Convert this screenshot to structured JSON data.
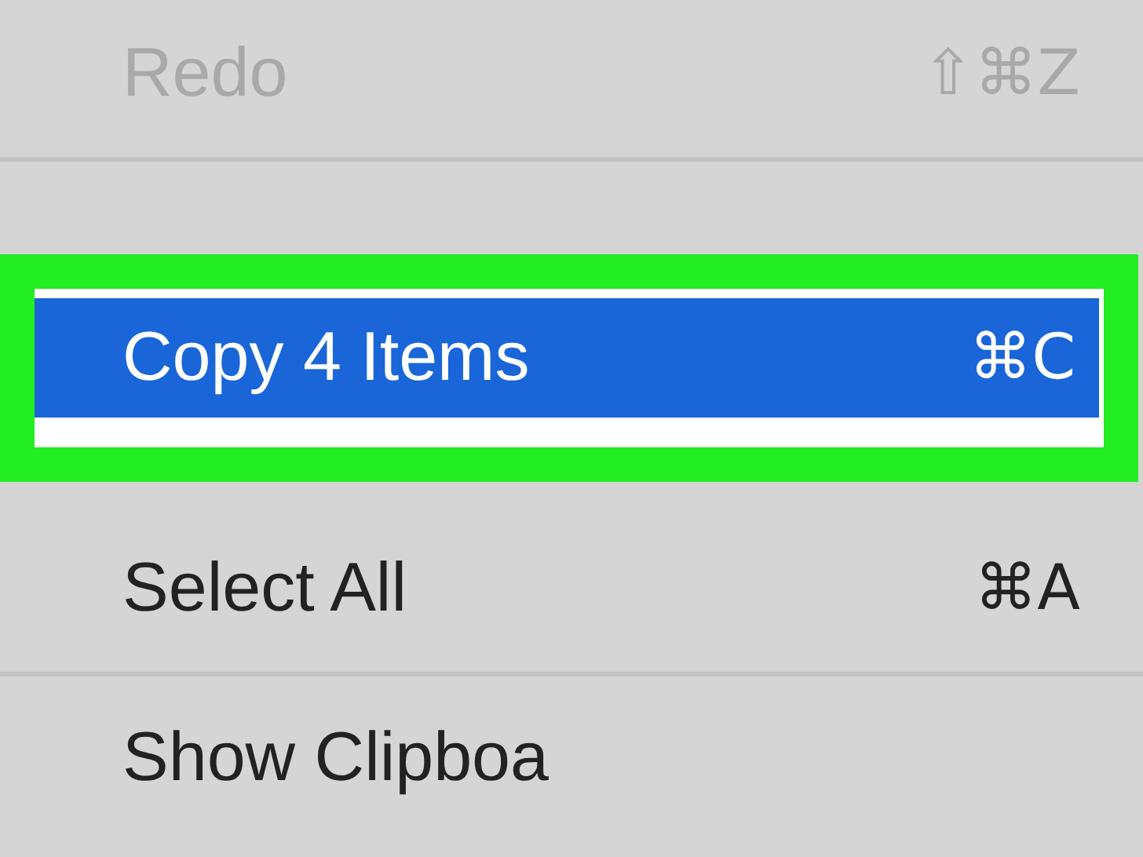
{
  "menu": {
    "items": [
      {
        "kind": "item",
        "label": "Redo",
        "shortcut": "⇧⌘Z",
        "disabled": true,
        "selected": false,
        "outlined": false
      },
      {
        "kind": "separator"
      },
      {
        "kind": "item",
        "label": "Copy 4 Items",
        "shortcut": "⌘C",
        "disabled": false,
        "selected": true,
        "outlined": true
      },
      {
        "kind": "item",
        "label": "Select All",
        "shortcut": "⌘A",
        "disabled": false,
        "selected": false,
        "outlined": false
      },
      {
        "kind": "separator"
      },
      {
        "kind": "item",
        "label": "Show Clipboa",
        "disabled": false,
        "selected": false,
        "outlined": false
      }
    ]
  }
}
